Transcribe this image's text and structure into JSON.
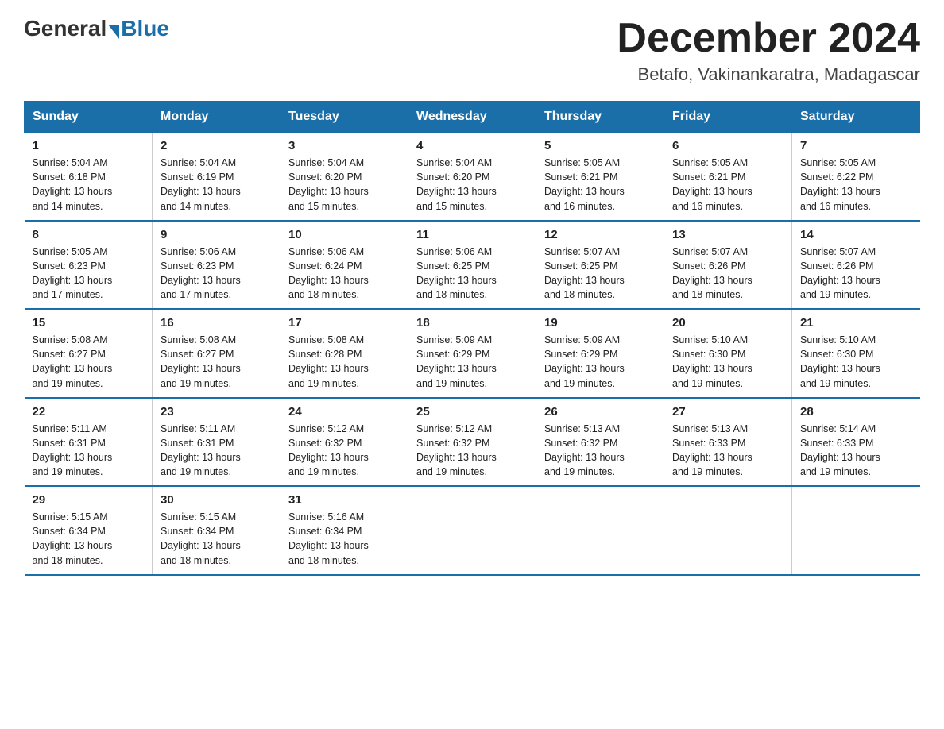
{
  "header": {
    "logo_general": "General",
    "logo_blue": "Blue",
    "month_title": "December 2024",
    "subtitle": "Betafo, Vakinankaratra, Madagascar"
  },
  "days_of_week": [
    "Sunday",
    "Monday",
    "Tuesday",
    "Wednesday",
    "Thursday",
    "Friday",
    "Saturday"
  ],
  "weeks": [
    [
      {
        "day": "1",
        "sunrise": "5:04 AM",
        "sunset": "6:18 PM",
        "daylight": "13 hours and 14 minutes."
      },
      {
        "day": "2",
        "sunrise": "5:04 AM",
        "sunset": "6:19 PM",
        "daylight": "13 hours and 14 minutes."
      },
      {
        "day": "3",
        "sunrise": "5:04 AM",
        "sunset": "6:20 PM",
        "daylight": "13 hours and 15 minutes."
      },
      {
        "day": "4",
        "sunrise": "5:04 AM",
        "sunset": "6:20 PM",
        "daylight": "13 hours and 15 minutes."
      },
      {
        "day": "5",
        "sunrise": "5:05 AM",
        "sunset": "6:21 PM",
        "daylight": "13 hours and 16 minutes."
      },
      {
        "day": "6",
        "sunrise": "5:05 AM",
        "sunset": "6:21 PM",
        "daylight": "13 hours and 16 minutes."
      },
      {
        "day": "7",
        "sunrise": "5:05 AM",
        "sunset": "6:22 PM",
        "daylight": "13 hours and 16 minutes."
      }
    ],
    [
      {
        "day": "8",
        "sunrise": "5:05 AM",
        "sunset": "6:23 PM",
        "daylight": "13 hours and 17 minutes."
      },
      {
        "day": "9",
        "sunrise": "5:06 AM",
        "sunset": "6:23 PM",
        "daylight": "13 hours and 17 minutes."
      },
      {
        "day": "10",
        "sunrise": "5:06 AM",
        "sunset": "6:24 PM",
        "daylight": "13 hours and 18 minutes."
      },
      {
        "day": "11",
        "sunrise": "5:06 AM",
        "sunset": "6:25 PM",
        "daylight": "13 hours and 18 minutes."
      },
      {
        "day": "12",
        "sunrise": "5:07 AM",
        "sunset": "6:25 PM",
        "daylight": "13 hours and 18 minutes."
      },
      {
        "day": "13",
        "sunrise": "5:07 AM",
        "sunset": "6:26 PM",
        "daylight": "13 hours and 18 minutes."
      },
      {
        "day": "14",
        "sunrise": "5:07 AM",
        "sunset": "6:26 PM",
        "daylight": "13 hours and 19 minutes."
      }
    ],
    [
      {
        "day": "15",
        "sunrise": "5:08 AM",
        "sunset": "6:27 PM",
        "daylight": "13 hours and 19 minutes."
      },
      {
        "day": "16",
        "sunrise": "5:08 AM",
        "sunset": "6:27 PM",
        "daylight": "13 hours and 19 minutes."
      },
      {
        "day": "17",
        "sunrise": "5:08 AM",
        "sunset": "6:28 PM",
        "daylight": "13 hours and 19 minutes."
      },
      {
        "day": "18",
        "sunrise": "5:09 AM",
        "sunset": "6:29 PM",
        "daylight": "13 hours and 19 minutes."
      },
      {
        "day": "19",
        "sunrise": "5:09 AM",
        "sunset": "6:29 PM",
        "daylight": "13 hours and 19 minutes."
      },
      {
        "day": "20",
        "sunrise": "5:10 AM",
        "sunset": "6:30 PM",
        "daylight": "13 hours and 19 minutes."
      },
      {
        "day": "21",
        "sunrise": "5:10 AM",
        "sunset": "6:30 PM",
        "daylight": "13 hours and 19 minutes."
      }
    ],
    [
      {
        "day": "22",
        "sunrise": "5:11 AM",
        "sunset": "6:31 PM",
        "daylight": "13 hours and 19 minutes."
      },
      {
        "day": "23",
        "sunrise": "5:11 AM",
        "sunset": "6:31 PM",
        "daylight": "13 hours and 19 minutes."
      },
      {
        "day": "24",
        "sunrise": "5:12 AM",
        "sunset": "6:32 PM",
        "daylight": "13 hours and 19 minutes."
      },
      {
        "day": "25",
        "sunrise": "5:12 AM",
        "sunset": "6:32 PM",
        "daylight": "13 hours and 19 minutes."
      },
      {
        "day": "26",
        "sunrise": "5:13 AM",
        "sunset": "6:32 PM",
        "daylight": "13 hours and 19 minutes."
      },
      {
        "day": "27",
        "sunrise": "5:13 AM",
        "sunset": "6:33 PM",
        "daylight": "13 hours and 19 minutes."
      },
      {
        "day": "28",
        "sunrise": "5:14 AM",
        "sunset": "6:33 PM",
        "daylight": "13 hours and 19 minutes."
      }
    ],
    [
      {
        "day": "29",
        "sunrise": "5:15 AM",
        "sunset": "6:34 PM",
        "daylight": "13 hours and 18 minutes."
      },
      {
        "day": "30",
        "sunrise": "5:15 AM",
        "sunset": "6:34 PM",
        "daylight": "13 hours and 18 minutes."
      },
      {
        "day": "31",
        "sunrise": "5:16 AM",
        "sunset": "6:34 PM",
        "daylight": "13 hours and 18 minutes."
      },
      {
        "day": "",
        "sunrise": "",
        "sunset": "",
        "daylight": ""
      },
      {
        "day": "",
        "sunrise": "",
        "sunset": "",
        "daylight": ""
      },
      {
        "day": "",
        "sunrise": "",
        "sunset": "",
        "daylight": ""
      },
      {
        "day": "",
        "sunrise": "",
        "sunset": "",
        "daylight": ""
      }
    ]
  ],
  "labels": {
    "sunrise": "Sunrise: ",
    "sunset": "Sunset: ",
    "daylight": "Daylight: "
  }
}
